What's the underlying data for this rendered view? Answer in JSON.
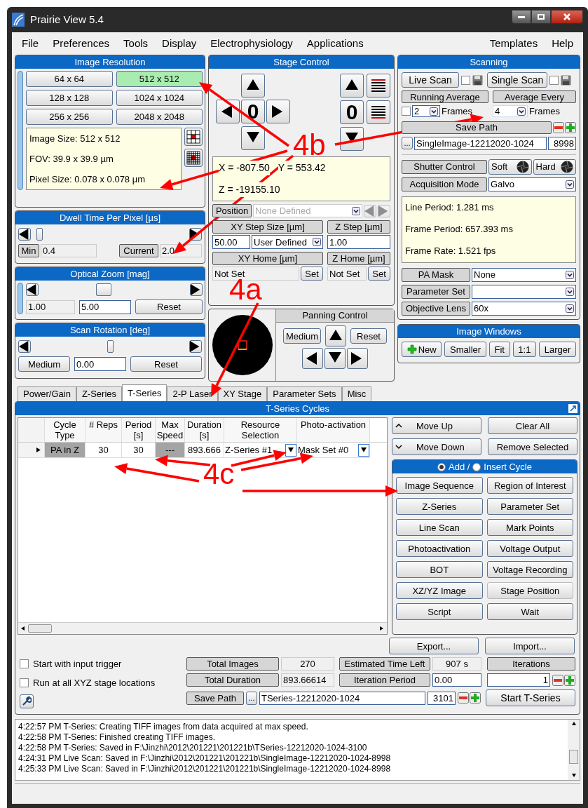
{
  "window": {
    "title": "Prairie View 5.4"
  },
  "menu_left": [
    {
      "label": "File"
    },
    {
      "label": "Preferences"
    },
    {
      "label": "Tools"
    },
    {
      "label": "Display"
    },
    {
      "label": "Electrophysiology"
    },
    {
      "label": "Applications"
    }
  ],
  "menu_right": [
    {
      "label": "Templates"
    },
    {
      "label": "Help"
    }
  ],
  "image_resolution": {
    "title": "Image Resolution",
    "options": [
      {
        "label": "64 x 64",
        "selected": false
      },
      {
        "label": "512 x 512",
        "selected": true
      },
      {
        "label": "128 x 128",
        "selected": false
      },
      {
        "label": "1024 x 1024",
        "selected": false
      },
      {
        "label": "256 x 256",
        "selected": false
      },
      {
        "label": "2048 x 2048",
        "selected": false
      }
    ],
    "info": [
      "Image Size: 512 x 512",
      "FOV: 39.9 x 39.9 µm",
      "Pixel Size: 0.078 x 0.078 µm"
    ]
  },
  "dwell_time": {
    "title": "Dwell Time Per Pixel [µs]",
    "level": 0.02,
    "min_label": "Min",
    "min_value": "0.4",
    "current_label": "Current",
    "current_value": "2.0"
  },
  "optical_zoom": {
    "title": "Optical Zoom [mag]",
    "level": 0.42,
    "min_value": "1.00",
    "value": "5.00",
    "reset": "Reset"
  },
  "scan_rotation": {
    "title": "Scan Rotation [deg]",
    "level": 0.5,
    "speed": "Medium",
    "value": "0.00",
    "reset": "Reset"
  },
  "stage_control": {
    "title": "Stage Control",
    "xy_zero": "0",
    "z_zero": "0",
    "x": "X = -807.50",
    "y": "Y = 553.42",
    "z": "Z = -19155.10",
    "position": {
      "label": "Position",
      "value": "None Defined"
    },
    "xy_step": {
      "label": "XY Step Size [µm]",
      "value": "50.00",
      "mode": "User Defined"
    },
    "z_step": {
      "label": "Z Step [µm]",
      "value": "1.00"
    },
    "xy_home": {
      "label": "XY Home [µm]",
      "value": "Not Set",
      "button": "Set"
    },
    "z_home": {
      "label": "Z Home [µm]",
      "value": "Not Set",
      "button": "Set"
    }
  },
  "panning": {
    "title": "Panning Control",
    "speed": "Medium",
    "reset": "Reset"
  },
  "scanning": {
    "title": "Scanning",
    "live_scan": {
      "label": "Live Scan",
      "save": false
    },
    "single_scan": {
      "label": "Single Scan",
      "save": false
    },
    "running_average": {
      "label": "Running Average",
      "checked": false,
      "value": "2",
      "unit": "Frames"
    },
    "average_every": {
      "label": "Average Every",
      "value": "4",
      "unit": "Frames"
    },
    "save_path": {
      "label": "Save Path",
      "browse": "...",
      "value": "SingleImage-12212020-1024",
      "number": "8998"
    },
    "shutter": {
      "label": "Shutter Control",
      "soft": "Soft",
      "hard": "Hard"
    },
    "acquisition_mode": {
      "label": "Acquisition Mode",
      "value": "Galvo"
    },
    "timing": [
      "Line Period: 1.281 ms",
      "Frame Period: 657.393 ms",
      "Frame Rate: 1.521 fps"
    ],
    "selects": [
      {
        "label": "PA Mask",
        "value": "None"
      },
      {
        "label": "Parameter Set"
      },
      {
        "label": "Objective Lens",
        "value": "60x"
      }
    ]
  },
  "image_windows": {
    "title": "Image Windows",
    "buttons": [
      {
        "label": "New",
        "kind": "add"
      },
      {
        "label": "Smaller",
        "kind": "plain"
      },
      {
        "label": "Fit",
        "kind": "plain"
      },
      {
        "label": "1:1",
        "kind": "plain"
      },
      {
        "label": "Larger",
        "kind": "plain"
      }
    ]
  },
  "tabs": [
    {
      "label": "Power/Gain",
      "selected": false
    },
    {
      "label": "Z-Series",
      "selected": false
    },
    {
      "label": "T-Series",
      "selected": true
    },
    {
      "label": "2-P Laser",
      "selected": false
    },
    {
      "label": "XY Stage",
      "selected": false
    },
    {
      "label": "Parameter Sets",
      "selected": false
    },
    {
      "label": "Misc",
      "selected": false
    }
  ],
  "tseries": {
    "title": "T-Series Cycles",
    "columns": [
      "Cycle Type",
      "# Reps",
      "Period [s]",
      "Max Speed",
      "Duration [s]",
      "Resource Selection",
      "Photo-activation"
    ],
    "rows": [
      {
        "cells": [
          "PA in Z",
          "30",
          "30",
          "---",
          "893.666",
          "Z-Series #1",
          "Mask Set #0"
        ]
      }
    ],
    "move_up": "Move Up",
    "clear_all": "Clear All",
    "move_down": "Move Down",
    "remove_selected": "Remove Selected",
    "add_label": "Add /",
    "insert_label": "Insert Cycle",
    "add_selected": true,
    "cycle_buttons": [
      {
        "label": "Image Sequence",
        "disabled": false
      },
      {
        "label": "Region of Interest",
        "disabled": false
      },
      {
        "label": "Z-Series",
        "disabled": false
      },
      {
        "label": "Parameter Set",
        "disabled": false
      },
      {
        "label": "Line Scan",
        "disabled": false
      },
      {
        "label": "Mark Points",
        "disabled": false
      },
      {
        "label": "Photoactivation",
        "disabled": false
      },
      {
        "label": "Voltage Output",
        "disabled": false
      },
      {
        "label": "BOT",
        "disabled": false
      },
      {
        "label": "Voltage Recording",
        "disabled": false
      },
      {
        "label": "XZ/YZ Image",
        "disabled": false
      },
      {
        "label": "Stage Position",
        "disabled": true
      },
      {
        "label": "Script",
        "disabled": false
      },
      {
        "label": "Wait",
        "disabled": false
      }
    ],
    "export": "Export...",
    "import": "Import...",
    "options": [
      {
        "label": "Start with input trigger",
        "checked": false
      },
      {
        "label": "Run at all XYZ stage locations",
        "checked": false
      }
    ],
    "total_images": {
      "label": "Total Images",
      "value": "270"
    },
    "total_duration": {
      "label": "Total Duration",
      "value": "893.66614"
    },
    "estimated": {
      "label": "Estimated Time Left",
      "value": "907 s"
    },
    "iteration_period": {
      "label": "Iteration Period",
      "value": "0.00"
    },
    "iterations": {
      "label": "Iterations",
      "value": "1"
    },
    "save_path": {
      "label": "Save Path",
      "browse": "...",
      "value": "TSeries-12212020-1024",
      "number": "3101"
    },
    "start": "Start T-Series"
  },
  "log": [
    "4:22:57 PM T-Series: Creating TIFF images from data acquired at max speed.",
    "4:22:58 PM T-Series: Finished creating TIFF images.",
    "4:22:58 PM T-Series: Saved in F:\\Jinzhi\\2012\\201221\\201221b\\TSeries-12212020-1024-3100",
    "4:24:31 PM Live Scan: Saved in F:\\Jinzhi\\2012\\201221\\201221b\\SingleImage-12212020-1024-8998",
    "4:25:33 PM Live Scan: Saved in F:\\Jinzhi\\2012\\201221\\201221b\\SingleImage-12212020-1024-8998"
  ],
  "annotations": [
    {
      "text": "4b"
    },
    {
      "text": "4a"
    },
    {
      "text": "4c"
    }
  ]
}
